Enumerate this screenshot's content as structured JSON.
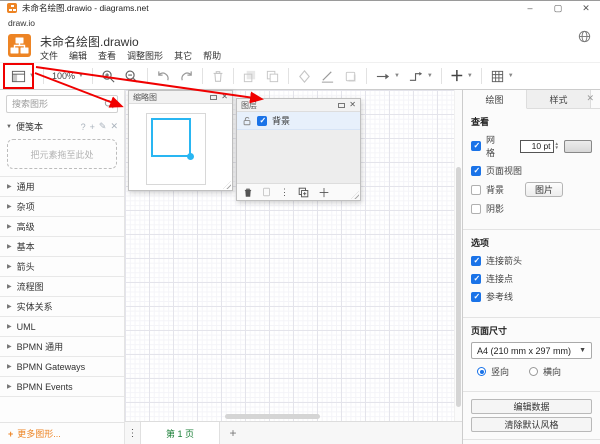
{
  "window": {
    "title": "未命名绘图.drawio - diagrams.net",
    "subbar": "draw.io",
    "controls": {
      "minimize": "–",
      "maximize": "▢",
      "close": "✕"
    }
  },
  "header": {
    "doc_title": "未命名绘图.drawio",
    "menus": [
      {
        "label": "文件"
      },
      {
        "label": "编辑"
      },
      {
        "label": "查看"
      },
      {
        "label": "调整图形"
      },
      {
        "label": "其它"
      },
      {
        "label": "帮助"
      }
    ]
  },
  "toolbar": {
    "zoom_value": "100%"
  },
  "sidebar": {
    "search_placeholder": "搜索图形",
    "scratchpad": {
      "label": "便笺本",
      "drop_hint": "把元素拖至此处",
      "help": "?",
      "add": "+",
      "edit": "✎",
      "close": "✕"
    },
    "sections": [
      {
        "label": "通用"
      },
      {
        "label": "杂项"
      },
      {
        "label": "高级"
      },
      {
        "label": "基本"
      },
      {
        "label": "箭头"
      },
      {
        "label": "流程图"
      },
      {
        "label": "实体关系"
      },
      {
        "label": "UML"
      },
      {
        "label": "BPMN 通用"
      },
      {
        "label": "BPMN Gateways"
      },
      {
        "label": "BPMN Events"
      }
    ],
    "more_shapes": {
      "plus": "+",
      "label": "更多图形..."
    }
  },
  "canvas": {
    "outline_panel": {
      "title": "缩略图",
      "close": "✕"
    },
    "layers_panel": {
      "title": "图层",
      "close": "✕",
      "layer": {
        "name": "背景",
        "visible": true
      }
    },
    "pagebar": {
      "menu": "⋮",
      "page_tab": "第 1 页",
      "add_page": "+"
    }
  },
  "format_panel": {
    "tabs": [
      {
        "label": "绘图",
        "active": true
      },
      {
        "label": "样式",
        "active": false
      }
    ],
    "close": "✕",
    "view": {
      "heading": "查看",
      "grid": {
        "label": "网格",
        "checked": true,
        "size": "10 pt"
      },
      "page_view": {
        "label": "页面视图",
        "checked": true
      },
      "background": {
        "label": "背景",
        "checked": false,
        "image_button": "图片"
      },
      "shadow": {
        "label": "阴影",
        "checked": false
      }
    },
    "options": {
      "heading": "选项",
      "items": [
        {
          "label": "连接箭头",
          "checked": true
        },
        {
          "label": "连接点",
          "checked": true
        },
        {
          "label": "参考线",
          "checked": true
        }
      ]
    },
    "page_size": {
      "heading": "页面尺寸",
      "value": "A4 (210 mm x 297 mm)",
      "portrait": {
        "label": "竖向",
        "selected": true
      },
      "landscape": {
        "label": "横向",
        "selected": false
      }
    },
    "buttons": [
      {
        "label": "编辑数据"
      },
      {
        "label": "清除默认风格"
      }
    ]
  },
  "colors": {
    "accent_orange": "#ED8424",
    "annotation_red": "#F00000",
    "selection_blue": "#1A73E8",
    "outline_viewport_blue": "#29B6F2",
    "page_tab_green": "#1A7F37"
  }
}
